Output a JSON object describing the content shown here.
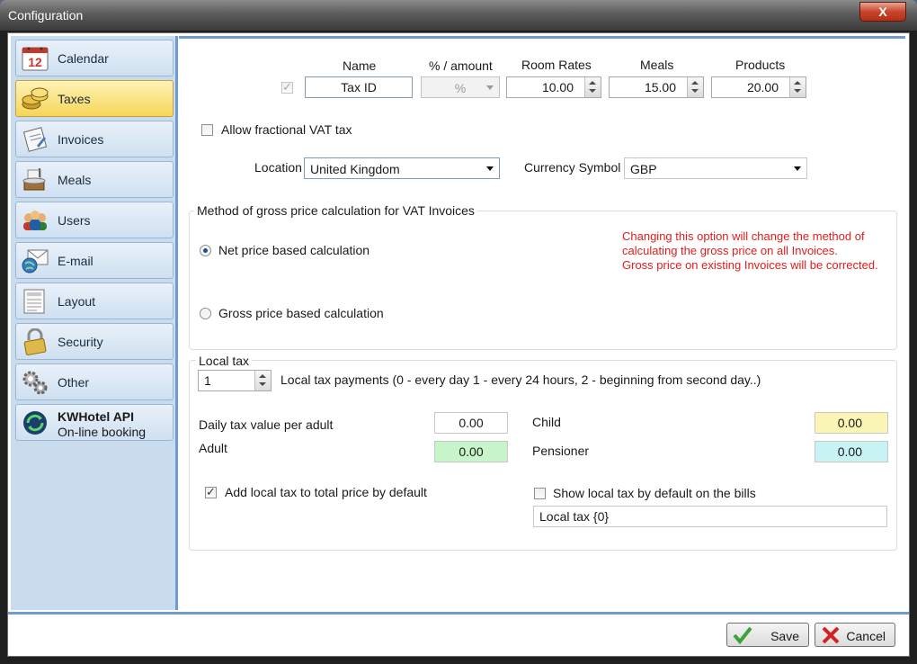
{
  "window": {
    "title": "Configuration",
    "close_glyph": "X"
  },
  "sidebar": {
    "items": [
      {
        "label": "Calendar",
        "icon": "calendar-icon",
        "day": "12"
      },
      {
        "label": "Taxes",
        "icon": "coins-icon",
        "active": true
      },
      {
        "label": "Invoices",
        "icon": "invoice-icon"
      },
      {
        "label": "Meals",
        "icon": "meals-icon"
      },
      {
        "label": "Users",
        "icon": "users-icon"
      },
      {
        "label": "E-mail",
        "icon": "email-icon"
      },
      {
        "label": "Layout",
        "icon": "layout-icon"
      },
      {
        "label": "Security",
        "icon": "lock-icon"
      },
      {
        "label": "Other",
        "icon": "gears-icon"
      }
    ],
    "api": {
      "title": "KWHotel API",
      "subtitle": "On-line booking",
      "icon": "sync-icon"
    }
  },
  "taxes": {
    "headers": {
      "name": "Name",
      "amount": "% / amount",
      "room_rates": "Room Rates",
      "meals": "Meals",
      "products": "Products"
    },
    "row": {
      "name": "Tax ID",
      "amount": "%",
      "room_rates": "10.00",
      "meals": "15.00",
      "products": "20.00"
    },
    "allow_fractional": "Allow fractional VAT tax",
    "location_label": "Location",
    "location": "United Kingdom",
    "currency_label": "Currency Symbol",
    "currency": "GBP"
  },
  "gross": {
    "title": "Method of gross price calculation for VAT Invoices",
    "net": "Net price based calculation",
    "gross": "Gross price based calculation",
    "warning": "Changing this option will change the method of\ncalculating the gross price on all Invoices.\nGross price on existing Invoices will be corrected."
  },
  "local_tax": {
    "title": "Local tax",
    "payments_value": "1",
    "payments_label": "Local tax payments (0 - every day 1 - every 24 hours,  2 - beginning from second day..)",
    "daily_label": "Daily tax value per adult",
    "daily_value": "0.00",
    "adult_label": "Adult",
    "adult_value": "0.00",
    "child_label": "Child",
    "child_value": "0.00",
    "pensioner_label": "Pensioner",
    "pensioner_value": "0.00",
    "add_default": "Add local tax to total price by default",
    "show_default": "Show local tax by default on the bills",
    "template": "Local tax {0}"
  },
  "footer": {
    "save": "Save",
    "cancel": "Cancel"
  },
  "colors": {
    "adult_bg": "#c7f4c8",
    "child_bg": "#fbf6b6",
    "pensioner_bg": "#c8f3f5",
    "warning": "#e21c1c",
    "accent": "#6f9ccc"
  }
}
